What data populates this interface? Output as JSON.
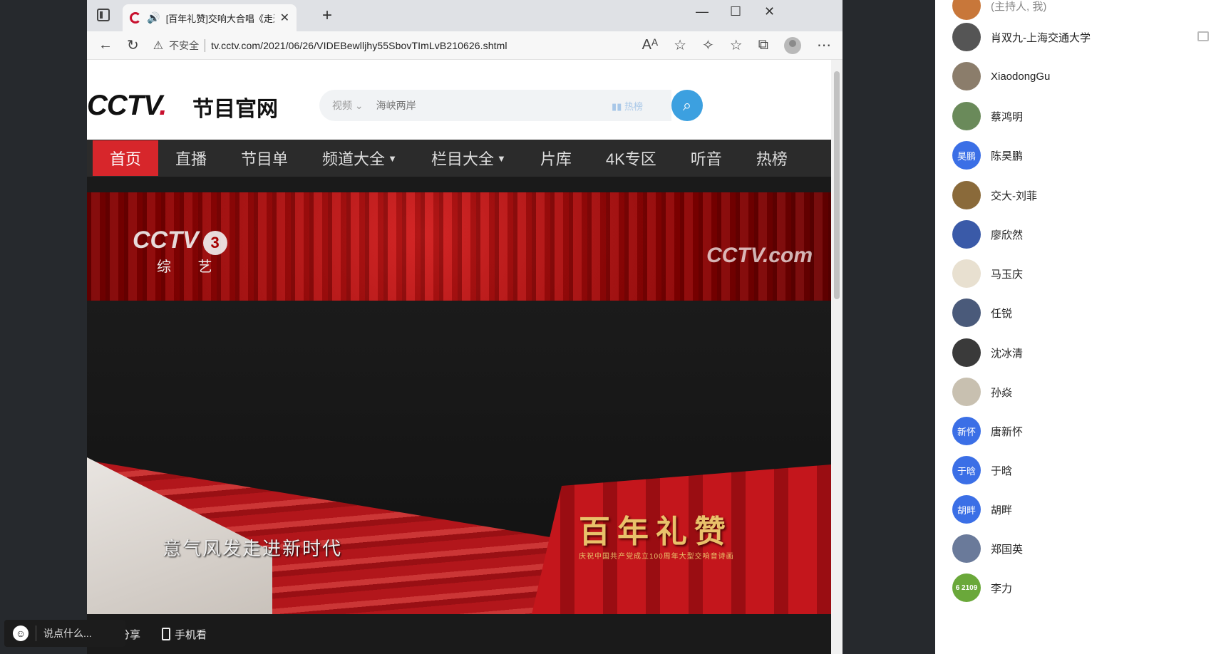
{
  "browser": {
    "tab_title": "[百年礼赞]交响大合唱《走进新时代》",
    "security_label": "不安全",
    "url": "tv.cctv.com/2021/06/26/VIDEBewlljhy55SbovTImLvB210626.shtml"
  },
  "site": {
    "logo_text": "CCTV",
    "logo_dot": ".",
    "logo_subtitle": "节目官网",
    "search": {
      "category": "视频",
      "placeholder": "海峡两岸",
      "hot_label": "热榜"
    },
    "nav": [
      {
        "label": "首页",
        "active": true
      },
      {
        "label": "直播"
      },
      {
        "label": "节目单"
      },
      {
        "label": "频道大全",
        "dropdown": true
      },
      {
        "label": "栏目大全",
        "dropdown": true
      },
      {
        "label": "片库"
      },
      {
        "label": "4K专区"
      },
      {
        "label": "听音"
      },
      {
        "label": "热榜"
      }
    ]
  },
  "video": {
    "channel_logo": "CCTV",
    "channel_number": "3",
    "channel_name": "综 艺",
    "watermark_right": "CCTV.com",
    "subtitle": "意气风发走进新时代",
    "program_title": "百年礼赞",
    "program_subtitle": "庆祝中国共产党成立100周年大型交响音诗画",
    "share_label": "分享",
    "phone_label": "手机看"
  },
  "chat": {
    "placeholder": "说点什么..."
  },
  "participants": [
    {
      "name": "(主持人, 我)",
      "avatar": "",
      "host": true
    },
    {
      "name": "肖双九-上海交通大学",
      "avatar": ""
    },
    {
      "name": "XiaodongGu",
      "avatar": ""
    },
    {
      "name": "蔡鸿明",
      "avatar": ""
    },
    {
      "name": "陈昊鹏",
      "avatar": "昊鹏",
      "blue": true
    },
    {
      "name": "交大-刘菲",
      "avatar": ""
    },
    {
      "name": "廖欣然",
      "avatar": ""
    },
    {
      "name": "马玉庆",
      "avatar": ""
    },
    {
      "name": "任锐",
      "avatar": ""
    },
    {
      "name": "沈冰清",
      "avatar": ""
    },
    {
      "name": "孙焱",
      "avatar": ""
    },
    {
      "name": "唐新怀",
      "avatar": "新怀",
      "blue": true
    },
    {
      "name": "于晗",
      "avatar": "于晗",
      "blue": true
    },
    {
      "name": "胡畔",
      "avatar": "胡畔",
      "blue": true
    },
    {
      "name": "郑国英",
      "avatar": ""
    },
    {
      "name": "李力",
      "avatar": "6 2109"
    }
  ]
}
